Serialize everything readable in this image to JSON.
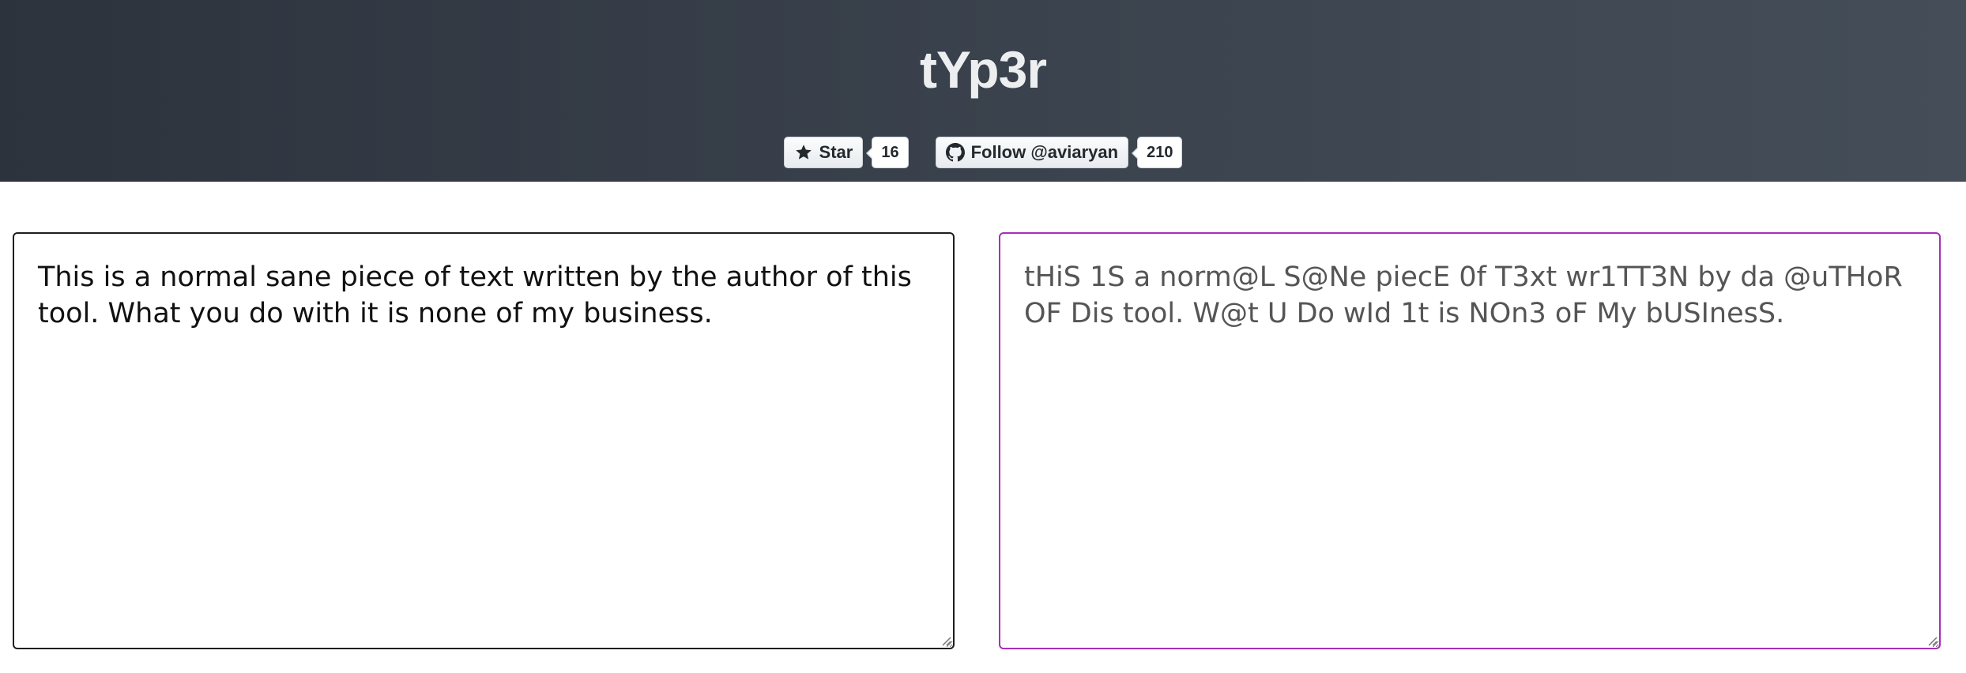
{
  "header": {
    "title": "tYp3r",
    "star_button": {
      "label": "Star",
      "icon": "star-icon",
      "count": "16"
    },
    "follow_button": {
      "label": "Follow @aviaryan",
      "icon": "github-icon",
      "count": "210"
    }
  },
  "editor": {
    "input_text": "This is a normal sane piece of text written by the author of this tool. What you do with it is none of my business.",
    "output_text": "tHiS 1S a norm@L S@Ne piecE 0f T3xt wr1TT3N by da @uTHoR OF Dis tool. W@t U Do wId 1t is NOn3 oF My bUSInesS."
  },
  "colors": {
    "header_bg_start": "#2d333d",
    "header_bg_end": "#444d58",
    "title_color": "#eceef0",
    "output_border": "#a62fb8",
    "input_border": "#1e1e1e"
  }
}
